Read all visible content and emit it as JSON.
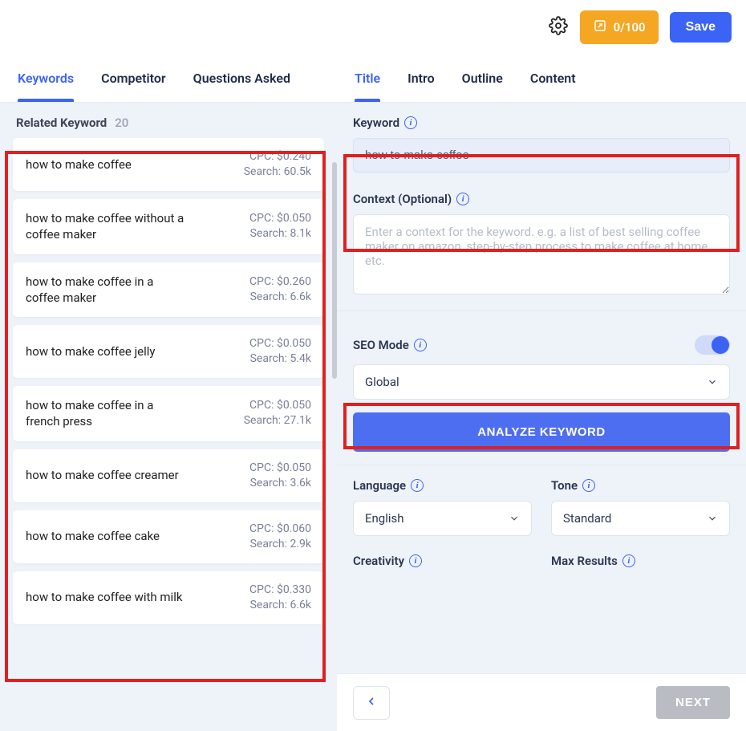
{
  "topbar": {
    "credits": "0/100",
    "save_label": "Save"
  },
  "left": {
    "tabs": [
      "Keywords",
      "Competitor",
      "Questions Asked"
    ],
    "active_tab": 0,
    "section_title": "Related Keyword",
    "section_count": "20",
    "keywords": [
      {
        "term": "how to make coffee",
        "cpc": "CPC: $0.240",
        "search": "Search: 60.5k"
      },
      {
        "term": "how to make coffee without a coffee maker",
        "cpc": "CPC: $0.050",
        "search": "Search: 8.1k"
      },
      {
        "term": "how to make coffee in a coffee maker",
        "cpc": "CPC: $0.260",
        "search": "Search: 6.6k"
      },
      {
        "term": "how to make coffee jelly",
        "cpc": "CPC: $0.050",
        "search": "Search: 5.4k"
      },
      {
        "term": "how to make coffee in a french press",
        "cpc": "CPC: $0.050",
        "search": "Search: 27.1k"
      },
      {
        "term": "how to make coffee creamer",
        "cpc": "CPC: $0.050",
        "search": "Search: 3.6k"
      },
      {
        "term": "how to make coffee cake",
        "cpc": "CPC: $0.060",
        "search": "Search: 2.9k"
      },
      {
        "term": "how to make coffee with milk",
        "cpc": "CPC: $0.330",
        "search": "Search: 6.6k"
      }
    ]
  },
  "right": {
    "tabs": [
      "Title",
      "Intro",
      "Outline",
      "Content"
    ],
    "active_tab": 0,
    "keyword_label": "Keyword",
    "keyword_value": "how to make coffee",
    "context_label": "Context (Optional)",
    "context_placeholder": "Enter a context for the keyword. e.g. a list of best selling coffee maker on amazon, step-by-step process to make coffee at home. etc.",
    "seo_mode_label": "SEO Mode",
    "seo_mode_on": true,
    "region_value": "Global",
    "analyze_label": "ANALYZE KEYWORD",
    "language_label": "Language",
    "language_value": "English",
    "tone_label": "Tone",
    "tone_value": "Standard",
    "creativity_label": "Creativity",
    "max_results_label": "Max Results",
    "next_label": "NEXT"
  }
}
